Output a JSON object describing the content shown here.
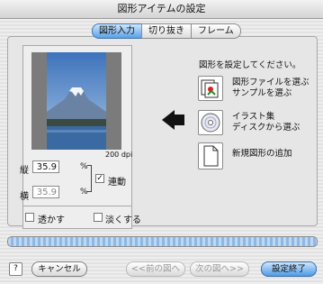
{
  "window": {
    "title": "図形アイテムの設定"
  },
  "tabs": [
    {
      "label": "図形入力",
      "active": true
    },
    {
      "label": "切り抜き",
      "active": false
    },
    {
      "label": "フレーム",
      "active": false
    }
  ],
  "preview": {
    "dpi_label": "200 dpi"
  },
  "size": {
    "height_label": "縦",
    "height_value": "35.9",
    "height_unit": "%",
    "width_label": "横",
    "width_value": "35.9",
    "width_unit": "%",
    "link_label": "連動",
    "link_checked": true
  },
  "options": {
    "transparent_label": "透かす",
    "transparent_checked": false,
    "faint_label": "淡くする",
    "faint_checked": false
  },
  "right": {
    "instruction": "図形を設定してください。",
    "items": [
      {
        "line1": "図形ファイルを選ぶ",
        "line2": "サンプルを選ぶ",
        "icon": "files-icon"
      },
      {
        "line1": "イラスト集",
        "line2": "ディスクから選ぶ",
        "icon": "cd-icon"
      },
      {
        "line1": "新規図形の追加",
        "line2": "",
        "icon": "new-document-icon"
      }
    ]
  },
  "buttons": {
    "help": "?",
    "cancel": "キャンセル",
    "prev": "<<前の図へ",
    "next": "次の図へ>>",
    "done": "設定終了"
  },
  "colors": {
    "accent": "#5aa1e6",
    "progress": "#8eb8e4"
  }
}
